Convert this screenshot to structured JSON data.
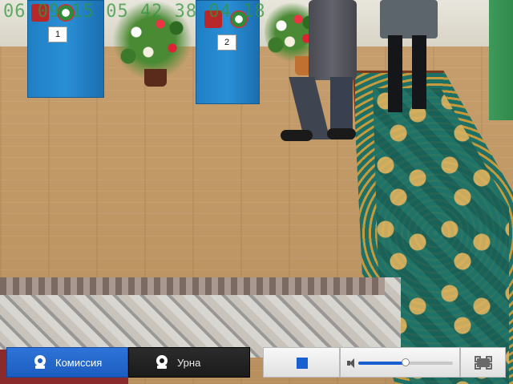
{
  "watermark": {
    "text": "06 09 15 05 42 38 04 18"
  },
  "booths": [
    {
      "number": "1"
    },
    {
      "number": "2"
    }
  ],
  "controls": {
    "tabs": [
      {
        "label": "Комиссия",
        "icon": "webcam-icon",
        "active": true
      },
      {
        "label": "Урна",
        "icon": "webcam-icon",
        "active": false
      }
    ],
    "stop": {
      "icon": "stop-icon"
    },
    "volume": {
      "icon": "speaker-icon",
      "level": 0.5
    },
    "fullscreen": {
      "icon": "fullscreen-icon"
    }
  },
  "colors": {
    "active_tab": "#1c5cc0",
    "inactive_tab": "#1a1a1a",
    "accent": "#1a5fd0",
    "booth_blue": "#2a8fd6"
  }
}
